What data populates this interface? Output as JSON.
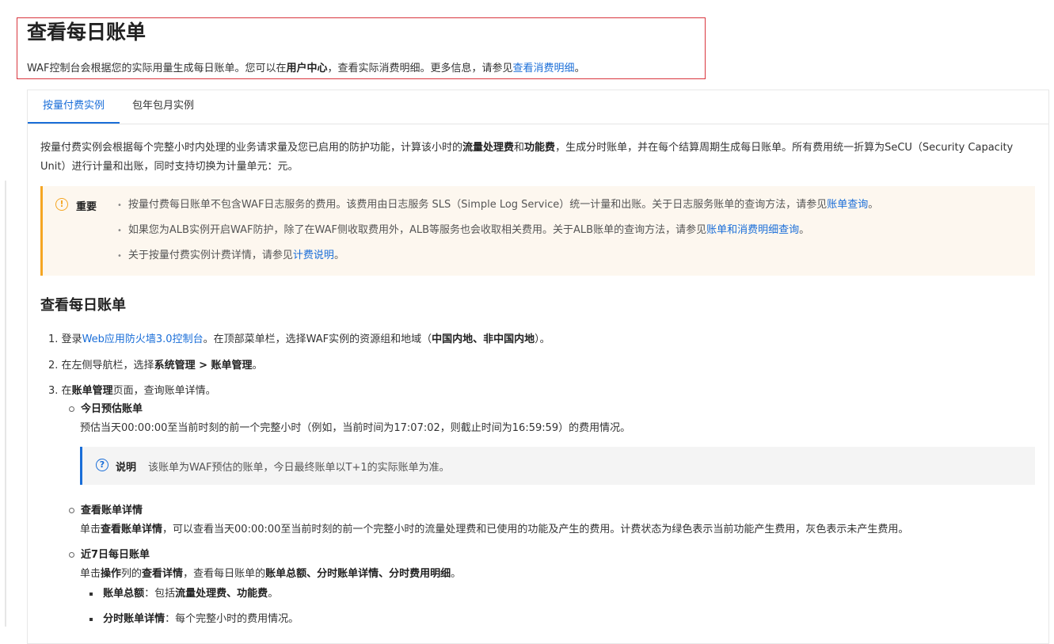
{
  "header": {
    "title": "查看每日账单",
    "intro_before": "WAF控制台会根据您的实际用量生成每日账单。您可以在",
    "intro_bold": "用户中心",
    "intro_middle": "，查看实际消费明细。更多信息，请参见",
    "intro_link": "查看消费明细",
    "intro_end": "。"
  },
  "tabs": [
    {
      "label": "按量付费实例",
      "active": true
    },
    {
      "label": "包年包月实例",
      "active": false
    }
  ],
  "description": {
    "t1": "按量付费实例会根据每个完整小时内处理的业务请求量及您已启用的防护功能，计算该小时的",
    "b1": "流量处理费",
    "t2": "和",
    "b2": "功能费",
    "t3": "，生成分时账单，并在每个结算周期生成每日账单。所有费用统一折算为SeCU（Security Capacity Unit）进行计量和出账，同时支持切换为计量单元：元。"
  },
  "notice": {
    "label": "重要",
    "icon": "warning-icon",
    "color": "#f5a623",
    "items": [
      {
        "text": "按量付费每日账单不包含WAF日志服务的费用。该费用由日志服务 SLS（Simple Log Service）统一计量和出账。关于日志服务账单的查询方法，请参见",
        "link": "账单查询",
        "end": "。"
      },
      {
        "text": "如果您为ALB实例开启WAF防护，除了在WAF侧收取费用外，ALB等服务也会收取相关费用。关于ALB账单的查询方法，请参见",
        "link": "账单和消费明细查询",
        "end": "。"
      },
      {
        "text": "关于按量付费实例计费详情，请参见",
        "link": "计费说明",
        "end": "。"
      }
    ]
  },
  "section": {
    "title": "查看每日账单",
    "step1": {
      "num": "1.",
      "t1": "登录",
      "link": "Web应用防火墙3.0控制台",
      "t2": "。在顶部菜单栏，选择WAF实例的资源组和地域（",
      "bold": "中国内地、非中国内地",
      "t3": "）。"
    },
    "step2": {
      "num": "2.",
      "t1": "在左侧导航栏，选择",
      "bold": "系统管理 > 账单管理",
      "t2": "。"
    },
    "step3": {
      "num": "3.",
      "t1": "在",
      "bold": "账单管理",
      "t2": "页面，查询账单详情。"
    },
    "today": {
      "title": "今日预估账单",
      "desc": "预估当天00:00:00至当前时刻的前一个完整小时（例如，当前时间为17:07:02，则截止时间为16:59:59）的费用情况。"
    },
    "note": {
      "label": "说明",
      "icon": "question-icon",
      "color": "#1a6ed8",
      "text": "该账单为WAF预估的账单，今日最终账单以T+1的实际账单为准。"
    },
    "detail": {
      "title": "查看账单详情",
      "t1": "单击",
      "bold": "查看账单详情",
      "t2": "，可以查看当天00:00:00至当前时刻的前一个完整小时的流量处理费和已使用的功能及产生的费用。计费状态为绿色表示当前功能产生费用，灰色表示未产生费用。"
    },
    "week": {
      "title": "近7日每日账单",
      "t1": "单击",
      "b1": "操作",
      "t2": "列的",
      "b2": "查看详情",
      "t3": "，查看每日账单的",
      "b3": "账单总额、分时账单详情、分时费用明细",
      "t4": "。"
    },
    "sub_items": [
      {
        "bold": "账单总额",
        "t1": "：包括",
        "b2": "流量处理费、功能费",
        "t2": "。"
      },
      {
        "bold": "分时账单详情",
        "t1": "：每个完整小时的费用情况。",
        "b2": "",
        "t2": ""
      }
    ]
  }
}
